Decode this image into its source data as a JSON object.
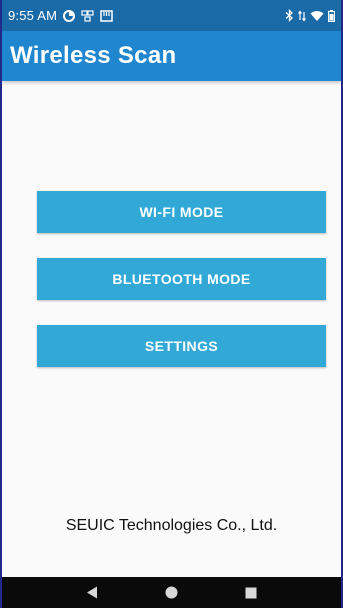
{
  "status_bar": {
    "time": "9:55 AM",
    "left_icons": [
      "data-saver-icon",
      "vpn-key-icon",
      "sd-card-icon"
    ],
    "right_icons": [
      "bluetooth-icon",
      "signal-arrows-icon",
      "wifi-icon",
      "battery-icon"
    ]
  },
  "app_bar": {
    "title": "Wireless Scan"
  },
  "buttons": {
    "wifi": "WI-FI MODE",
    "bluetooth": "BLUETOOTH MODE",
    "settings": "SETTINGS"
  },
  "footer": {
    "company": "SEUIC Technologies Co., Ltd."
  },
  "nav_bar": {
    "icons": [
      "back-icon",
      "home-icon",
      "recents-icon"
    ]
  },
  "colors": {
    "status_bar": "#1a6aa8",
    "app_bar": "#2186d0",
    "button": "#32a8d7",
    "nav_bar": "#0a0a0a"
  }
}
